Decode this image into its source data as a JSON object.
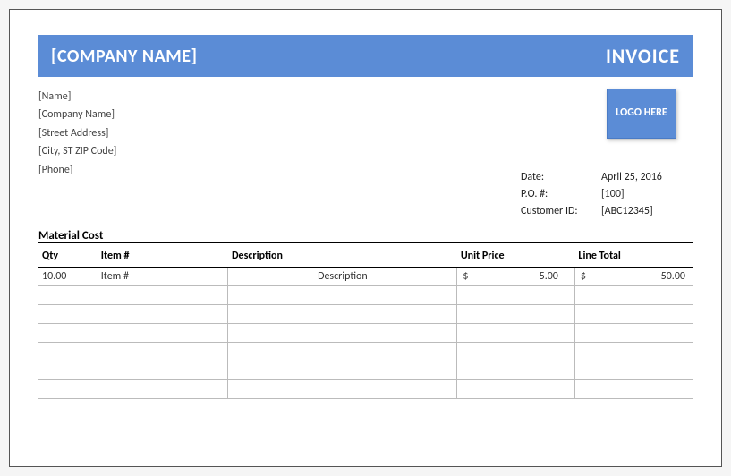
{
  "header": {
    "company_placeholder": "[COMPANY NAME]",
    "title": "INVOICE"
  },
  "billto": {
    "name": "[Name]",
    "company": "[Company Name]",
    "street": "[Street Address]",
    "city_state_zip": "[City, ST  ZIP Code]",
    "phone": "[Phone]"
  },
  "logo_text": "LOGO HERE",
  "meta": {
    "date_label": "Date:",
    "date_value": "April 25, 2016",
    "po_label": "P.O. #:",
    "po_value": "[100]",
    "customer_label": "Customer ID:",
    "customer_value": "[ABC12345]"
  },
  "section": {
    "material_title": "Material Cost"
  },
  "table": {
    "headers": {
      "qty": "Qty",
      "item": "Item #",
      "desc": "Description",
      "unit": "Unit Price",
      "total": "Line Total"
    },
    "rows": [
      {
        "qty": "10.00",
        "item": "Item #",
        "desc": "Description",
        "unit_sym": "$",
        "unit_val": "5.00",
        "total_sym": "$",
        "total_val": "50.00"
      },
      {
        "qty": "",
        "item": "",
        "desc": "",
        "unit_sym": "",
        "unit_val": "",
        "total_sym": "",
        "total_val": ""
      },
      {
        "qty": "",
        "item": "",
        "desc": "",
        "unit_sym": "",
        "unit_val": "",
        "total_sym": "",
        "total_val": ""
      },
      {
        "qty": "",
        "item": "",
        "desc": "",
        "unit_sym": "",
        "unit_val": "",
        "total_sym": "",
        "total_val": ""
      },
      {
        "qty": "",
        "item": "",
        "desc": "",
        "unit_sym": "",
        "unit_val": "",
        "total_sym": "",
        "total_val": ""
      },
      {
        "qty": "",
        "item": "",
        "desc": "",
        "unit_sym": "",
        "unit_val": "",
        "total_sym": "",
        "total_val": ""
      },
      {
        "qty": "",
        "item": "",
        "desc": "",
        "unit_sym": "",
        "unit_val": "",
        "total_sym": "",
        "total_val": ""
      }
    ]
  }
}
